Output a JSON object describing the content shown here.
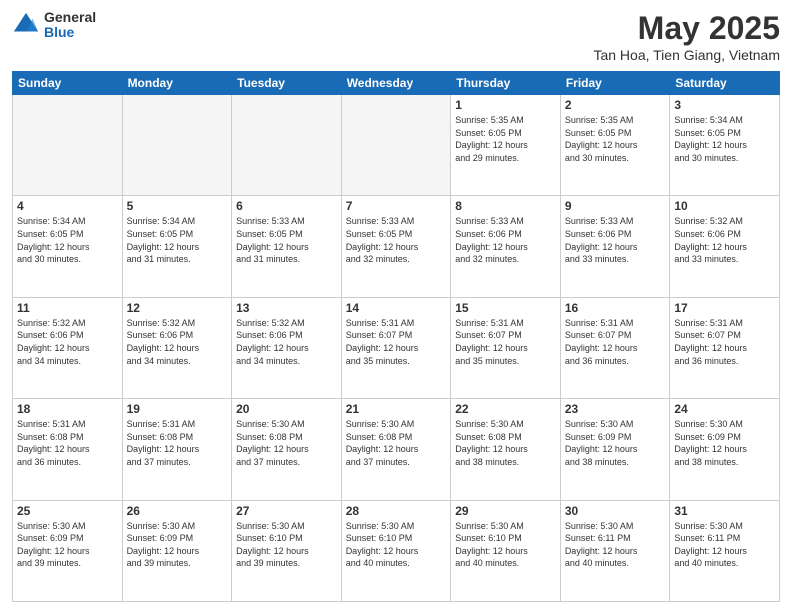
{
  "logo": {
    "general": "General",
    "blue": "Blue"
  },
  "title": "May 2025",
  "subtitle": "Tan Hoa, Tien Giang, Vietnam",
  "days_of_week": [
    "Sunday",
    "Monday",
    "Tuesday",
    "Wednesday",
    "Thursday",
    "Friday",
    "Saturday"
  ],
  "weeks": [
    [
      {
        "day": "",
        "info": ""
      },
      {
        "day": "",
        "info": ""
      },
      {
        "day": "",
        "info": ""
      },
      {
        "day": "",
        "info": ""
      },
      {
        "day": "1",
        "info": "Sunrise: 5:35 AM\nSunset: 6:05 PM\nDaylight: 12 hours\nand 29 minutes."
      },
      {
        "day": "2",
        "info": "Sunrise: 5:35 AM\nSunset: 6:05 PM\nDaylight: 12 hours\nand 30 minutes."
      },
      {
        "day": "3",
        "info": "Sunrise: 5:34 AM\nSunset: 6:05 PM\nDaylight: 12 hours\nand 30 minutes."
      }
    ],
    [
      {
        "day": "4",
        "info": "Sunrise: 5:34 AM\nSunset: 6:05 PM\nDaylight: 12 hours\nand 30 minutes."
      },
      {
        "day": "5",
        "info": "Sunrise: 5:34 AM\nSunset: 6:05 PM\nDaylight: 12 hours\nand 31 minutes."
      },
      {
        "day": "6",
        "info": "Sunrise: 5:33 AM\nSunset: 6:05 PM\nDaylight: 12 hours\nand 31 minutes."
      },
      {
        "day": "7",
        "info": "Sunrise: 5:33 AM\nSunset: 6:05 PM\nDaylight: 12 hours\nand 32 minutes."
      },
      {
        "day": "8",
        "info": "Sunrise: 5:33 AM\nSunset: 6:06 PM\nDaylight: 12 hours\nand 32 minutes."
      },
      {
        "day": "9",
        "info": "Sunrise: 5:33 AM\nSunset: 6:06 PM\nDaylight: 12 hours\nand 33 minutes."
      },
      {
        "day": "10",
        "info": "Sunrise: 5:32 AM\nSunset: 6:06 PM\nDaylight: 12 hours\nand 33 minutes."
      }
    ],
    [
      {
        "day": "11",
        "info": "Sunrise: 5:32 AM\nSunset: 6:06 PM\nDaylight: 12 hours\nand 34 minutes."
      },
      {
        "day": "12",
        "info": "Sunrise: 5:32 AM\nSunset: 6:06 PM\nDaylight: 12 hours\nand 34 minutes."
      },
      {
        "day": "13",
        "info": "Sunrise: 5:32 AM\nSunset: 6:06 PM\nDaylight: 12 hours\nand 34 minutes."
      },
      {
        "day": "14",
        "info": "Sunrise: 5:31 AM\nSunset: 6:07 PM\nDaylight: 12 hours\nand 35 minutes."
      },
      {
        "day": "15",
        "info": "Sunrise: 5:31 AM\nSunset: 6:07 PM\nDaylight: 12 hours\nand 35 minutes."
      },
      {
        "day": "16",
        "info": "Sunrise: 5:31 AM\nSunset: 6:07 PM\nDaylight: 12 hours\nand 36 minutes."
      },
      {
        "day": "17",
        "info": "Sunrise: 5:31 AM\nSunset: 6:07 PM\nDaylight: 12 hours\nand 36 minutes."
      }
    ],
    [
      {
        "day": "18",
        "info": "Sunrise: 5:31 AM\nSunset: 6:08 PM\nDaylight: 12 hours\nand 36 minutes."
      },
      {
        "day": "19",
        "info": "Sunrise: 5:31 AM\nSunset: 6:08 PM\nDaylight: 12 hours\nand 37 minutes."
      },
      {
        "day": "20",
        "info": "Sunrise: 5:30 AM\nSunset: 6:08 PM\nDaylight: 12 hours\nand 37 minutes."
      },
      {
        "day": "21",
        "info": "Sunrise: 5:30 AM\nSunset: 6:08 PM\nDaylight: 12 hours\nand 37 minutes."
      },
      {
        "day": "22",
        "info": "Sunrise: 5:30 AM\nSunset: 6:08 PM\nDaylight: 12 hours\nand 38 minutes."
      },
      {
        "day": "23",
        "info": "Sunrise: 5:30 AM\nSunset: 6:09 PM\nDaylight: 12 hours\nand 38 minutes."
      },
      {
        "day": "24",
        "info": "Sunrise: 5:30 AM\nSunset: 6:09 PM\nDaylight: 12 hours\nand 38 minutes."
      }
    ],
    [
      {
        "day": "25",
        "info": "Sunrise: 5:30 AM\nSunset: 6:09 PM\nDaylight: 12 hours\nand 39 minutes."
      },
      {
        "day": "26",
        "info": "Sunrise: 5:30 AM\nSunset: 6:09 PM\nDaylight: 12 hours\nand 39 minutes."
      },
      {
        "day": "27",
        "info": "Sunrise: 5:30 AM\nSunset: 6:10 PM\nDaylight: 12 hours\nand 39 minutes."
      },
      {
        "day": "28",
        "info": "Sunrise: 5:30 AM\nSunset: 6:10 PM\nDaylight: 12 hours\nand 40 minutes."
      },
      {
        "day": "29",
        "info": "Sunrise: 5:30 AM\nSunset: 6:10 PM\nDaylight: 12 hours\nand 40 minutes."
      },
      {
        "day": "30",
        "info": "Sunrise: 5:30 AM\nSunset: 6:11 PM\nDaylight: 12 hours\nand 40 minutes."
      },
      {
        "day": "31",
        "info": "Sunrise: 5:30 AM\nSunset: 6:11 PM\nDaylight: 12 hours\nand 40 minutes."
      }
    ]
  ]
}
